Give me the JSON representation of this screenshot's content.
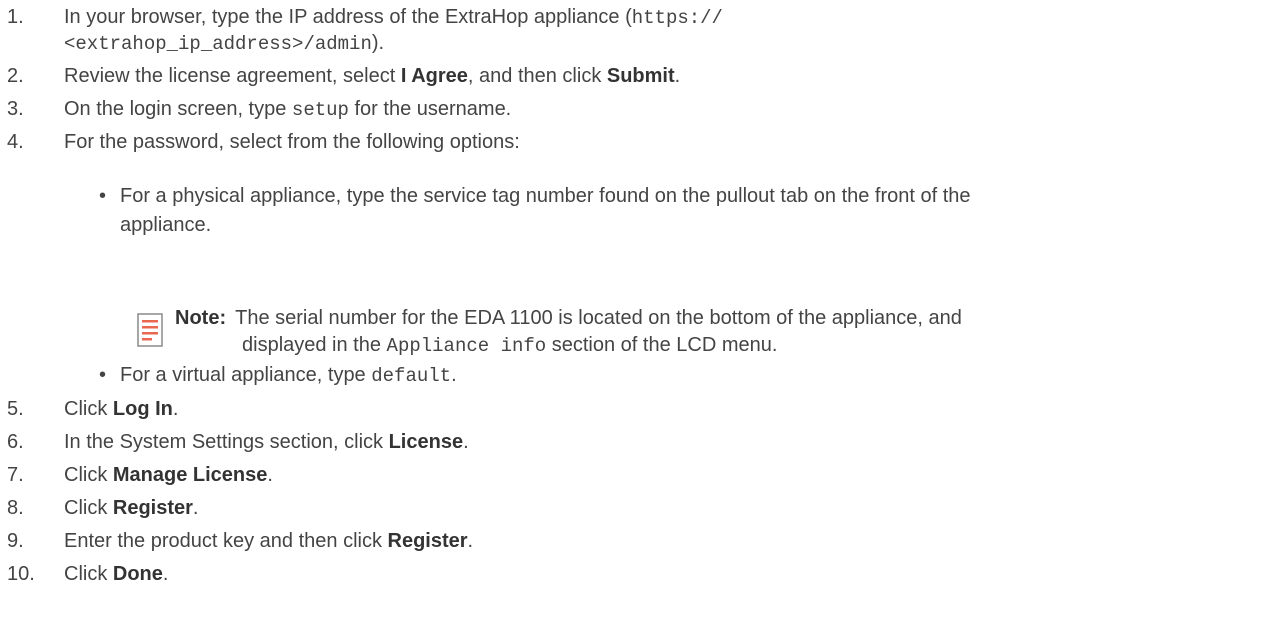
{
  "steps": [
    {
      "number": "1.",
      "text_before": "In your browser, type the IP address of the ExtraHop appliance (",
      "code_line1": "https://",
      "code_line2": "<extrahop_ip_address>/admin",
      "text_after": ")."
    },
    {
      "number": "2.",
      "text_a": "Review the license agreement, select ",
      "bold_a": "I Agree",
      "text_b": ", and then click ",
      "bold_b": "Submit",
      "text_c": "."
    },
    {
      "number": "3.",
      "text_a": "On the login screen, type ",
      "code": "setup",
      "text_b": " for the username."
    },
    {
      "number": "4.",
      "text": "For the password, select from the following options:",
      "options": [
        {
          "line1": "For a physical appliance, type the service tag number found on the pullout tab on the front of the",
          "line2": "appliance."
        },
        {
          "text": "For a virtual appliance, type ",
          "code": "default",
          "text_after": "."
        }
      ],
      "note": {
        "label": "Note:",
        "line1": "The serial number for the EDA 1100 is located on the bottom of the appliance, and",
        "line2_before": "displayed in the ",
        "line2_code": "Appliance info",
        "line2_after": " section of the LCD menu."
      }
    },
    {
      "number": "5.",
      "text": "Click ",
      "bold": "Log In",
      "after": "."
    },
    {
      "number": "6.",
      "text": "In the System Settings section, click ",
      "bold": "License",
      "after": "."
    },
    {
      "number": "7.",
      "text": "Click ",
      "bold": "Manage License",
      "after": "."
    },
    {
      "number": "8.",
      "text": "Click ",
      "bold": "Register",
      "after": "."
    },
    {
      "number": "9.",
      "text": "Enter the product key and then click ",
      "bold": "Register",
      "after": "."
    },
    {
      "number": "10.",
      "text": "Click ",
      "bold": "Done",
      "after": "."
    }
  ],
  "bullet_glyph": "•",
  "icon": "note-icon",
  "note_icon_color": "#e8694f"
}
